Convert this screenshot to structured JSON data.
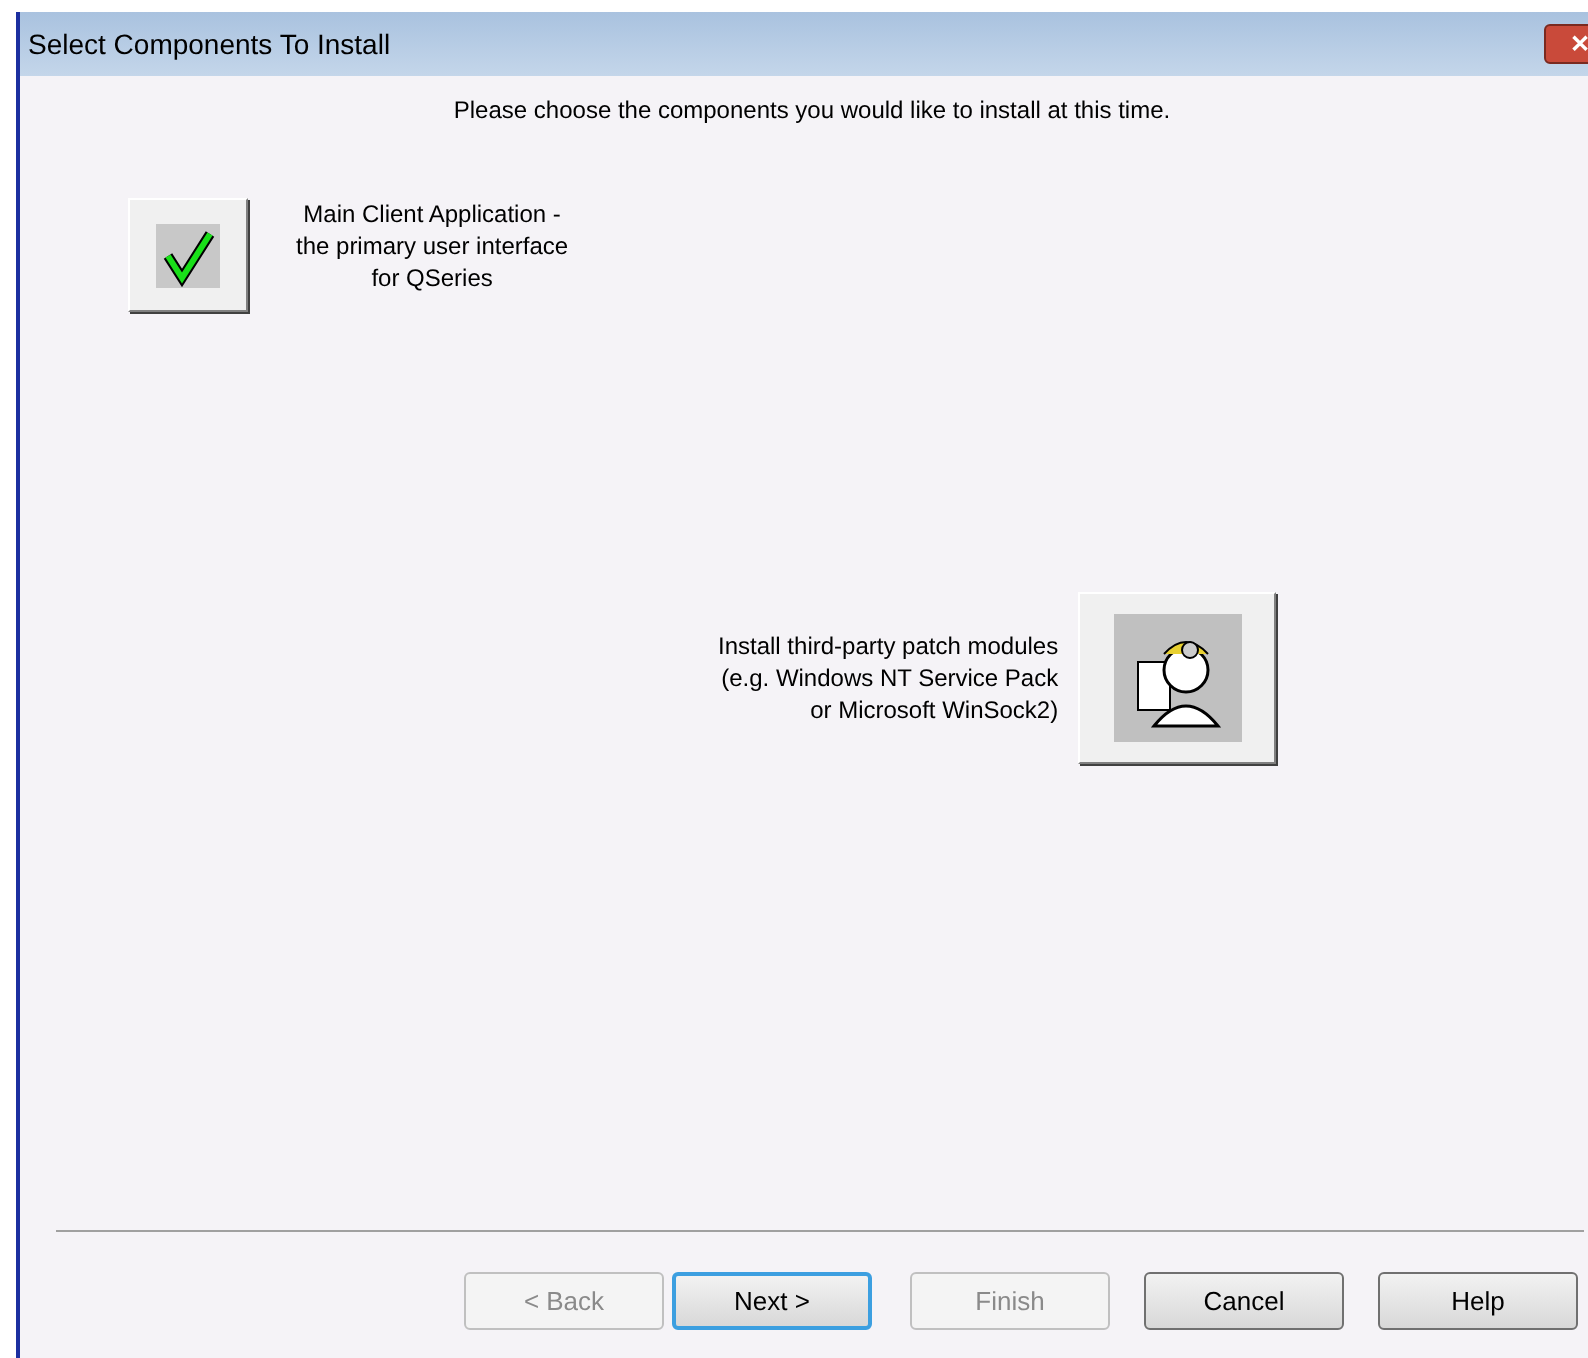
{
  "window": {
    "title": "Select Components To Install",
    "close": "✕"
  },
  "instruction": "Please choose the components you would like to install at this time.",
  "components": [
    {
      "kind": "check",
      "icon_first": true,
      "text": "Main Client Application -\nthe primary user interface\nfor QSeries"
    },
    {
      "kind": "person",
      "icon_first": false,
      "text": "Install third-party patch modules\n(e.g. Windows NT Service Pack\nor Microsoft WinSock2)"
    }
  ],
  "buttons": [
    {
      "label": "< Back",
      "disabled": true,
      "default": false
    },
    {
      "label": "Next >",
      "disabled": false,
      "default": true
    },
    {
      "label": "Finish",
      "disabled": true,
      "default": false
    },
    {
      "label": "Cancel",
      "disabled": false,
      "default": false
    },
    {
      "label": "Help",
      "disabled": false,
      "default": false
    }
  ]
}
